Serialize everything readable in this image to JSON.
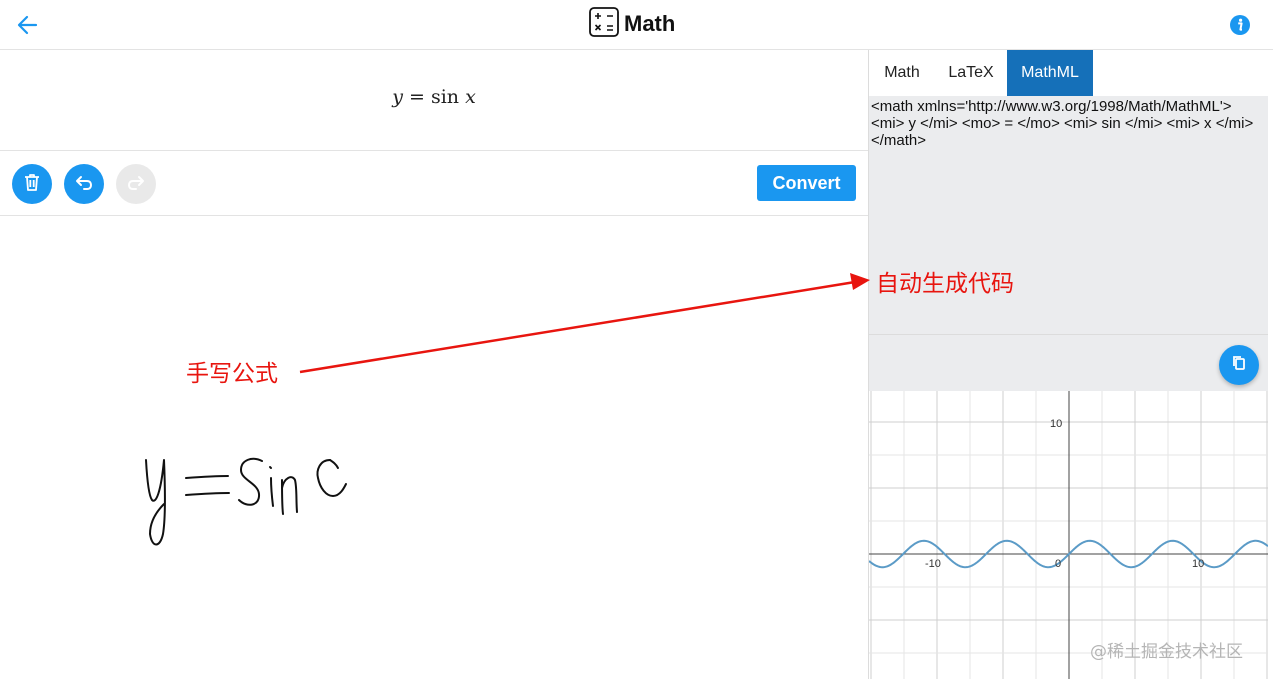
{
  "header": {
    "title": "Math",
    "icons": {
      "back": "arrow-left-icon",
      "app": "calculator-icon",
      "info": "info-icon"
    },
    "accent_color": "#1a97f0"
  },
  "formula": {
    "lhs": "y",
    "eq": "=",
    "func": "sin",
    "arg": "x"
  },
  "toolbar": {
    "icons": [
      "trash-icon",
      "undo-icon",
      "redo-icon"
    ],
    "redo_enabled": false,
    "convert_label": "Convert"
  },
  "tabs": {
    "items": [
      {
        "label": "Math",
        "active": false
      },
      {
        "label": "LaTeX",
        "active": false
      },
      {
        "label": "MathML",
        "active": true
      }
    ],
    "active_color": "#1570b9"
  },
  "code_output": {
    "text": "<math xmlns='http://www.w3.org/1998/Math/MathML'> <mi> y </mi> <mo> = </mo> <mi> sin </mi> <mi> x </mi> </math>",
    "copy_icon": "copy-icon"
  },
  "graph": {
    "y_tick_label": "10",
    "x_tick_labels": [
      "-10",
      "0",
      "10"
    ],
    "curve_color": "#5b9bc7"
  },
  "annotations": {
    "handwriting_label": "手写公式",
    "generated_label": "自动生成代码",
    "color": "#e8150f"
  },
  "watermark": "@稀土掘金技术社区"
}
